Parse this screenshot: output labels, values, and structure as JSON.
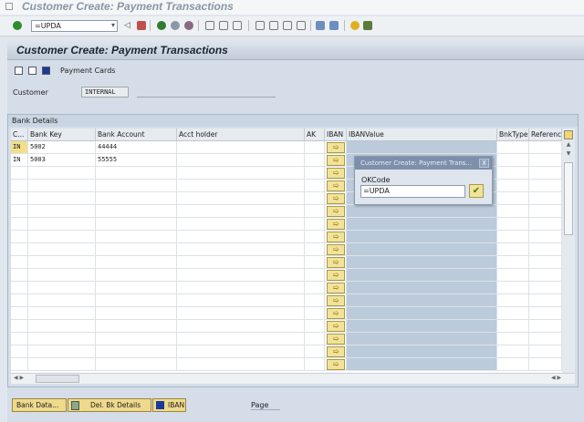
{
  "window_title": "Customer Create: Payment Transactions",
  "okcode": {
    "value": "=UPDA"
  },
  "header": {
    "title": "Customer Create: Payment Transactions"
  },
  "appbar": {
    "payment_cards": "Payment Cards"
  },
  "customer": {
    "label": "Customer",
    "value": "INTERNAL",
    "name": ""
  },
  "bank_details": {
    "title": "Bank Details",
    "columns": [
      "C...",
      "Bank Key",
      "Bank Account",
      "Acct holder",
      "AK",
      "IBAN",
      "IBANValue",
      "BnkType",
      "Referenc"
    ],
    "rows": [
      {
        "c": "IN",
        "bank_key": "5002",
        "account": "44444"
      },
      {
        "c": "IN",
        "bank_key": "5003",
        "account": "55555"
      }
    ]
  },
  "popup": {
    "title": "Customer Create: Payment Trans...",
    "label": "OKCode",
    "value": "=UPDA"
  },
  "buttons": {
    "bank_data": "Bank Data...",
    "del": "Del. Bk Details",
    "iban": "IBAN"
  },
  "page_label": "Page"
}
